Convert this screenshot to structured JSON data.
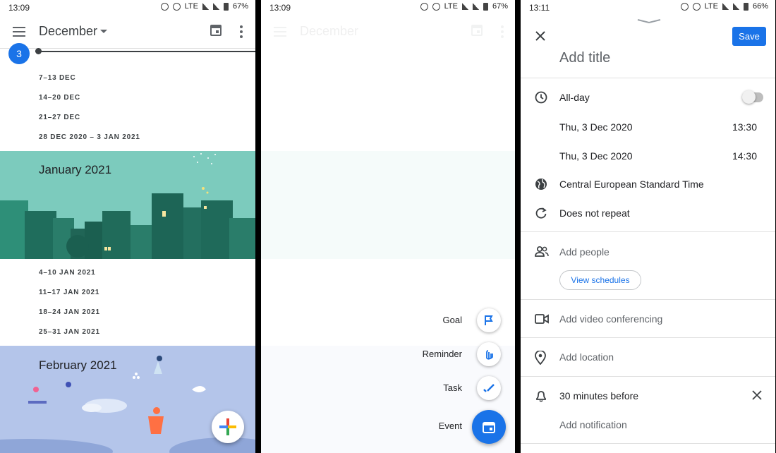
{
  "colors": {
    "accent": "#1a73e8",
    "jan_banner": "#7ccbbd",
    "feb_banner": "#b4c5ea",
    "text": "#202124",
    "muted": "#5f6368"
  },
  "panel1": {
    "status": {
      "time": "13:09",
      "lte": "LTE",
      "battery": "67%"
    },
    "header": {
      "month": "December"
    },
    "today_day": "3",
    "december_weeks": [
      "7–13 DEC",
      "14–20 DEC",
      "21–27 DEC",
      "28 DEC 2020 – 3 JAN 2021"
    ],
    "jan_banner_title": "January 2021",
    "january_weeks": [
      "4–10 JAN 2021",
      "11–17 JAN 2021",
      "18–24 JAN 2021",
      "25–31 JAN 2021"
    ],
    "feb_banner_title": "February 2021"
  },
  "panel2": {
    "status": {
      "time": "13:09",
      "lte": "LTE",
      "battery": "67%"
    },
    "header": {
      "month": "December"
    },
    "speed_dial": {
      "goal": "Goal",
      "reminder": "Reminder",
      "task": "Task",
      "event": "Event"
    },
    "icons": {
      "goal": "flag-icon",
      "reminder": "reminder-hand-icon",
      "task": "check-task-icon",
      "event": "calendar-event-icon"
    }
  },
  "panel3": {
    "status": {
      "time": "13:11",
      "lte": "LTE",
      "battery": "66%"
    },
    "save_label": "Save",
    "title_placeholder": "Add title",
    "all_day_label": "All-day",
    "all_day_enabled": false,
    "start": {
      "date": "Thu, 3 Dec 2020",
      "time": "13:30"
    },
    "end": {
      "date": "Thu, 3 Dec 2020",
      "time": "14:30"
    },
    "timezone": "Central European Standard Time",
    "repeat": "Does not repeat",
    "add_people": "Add people",
    "view_schedules": "View schedules",
    "video_conferencing": "Add video conferencing",
    "location": "Add location",
    "notification": "30 minutes before",
    "add_notification": "Add notification"
  }
}
